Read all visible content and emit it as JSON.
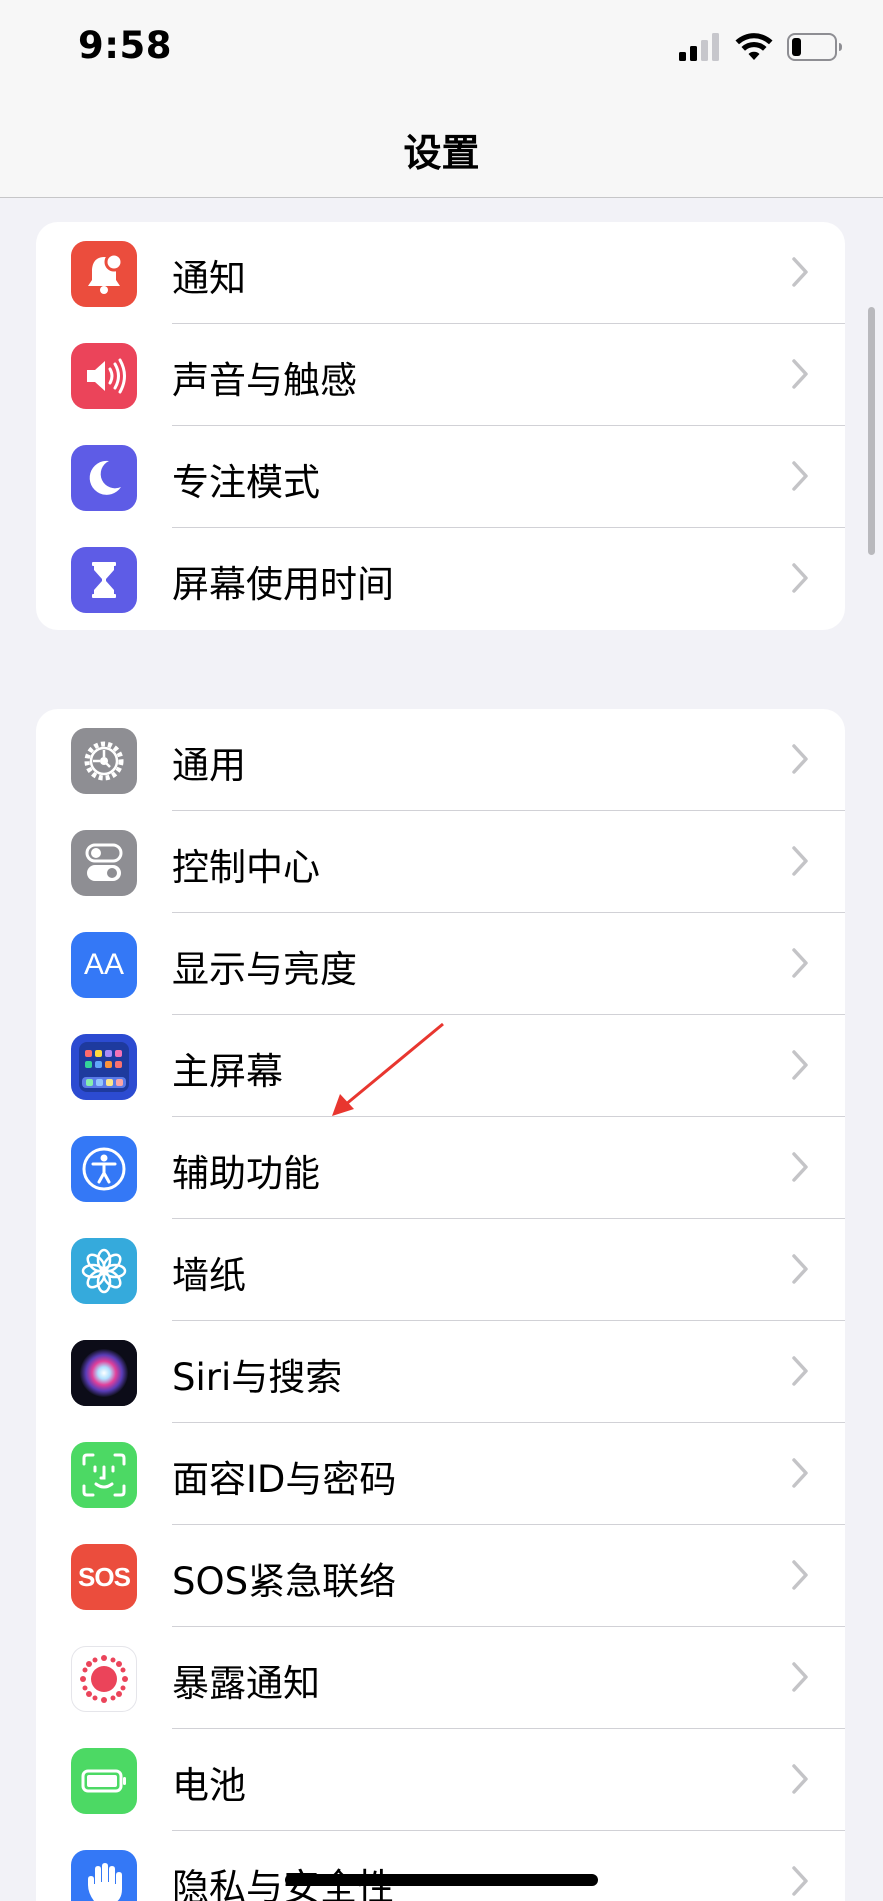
{
  "status_bar": {
    "time": "9:58",
    "icons": [
      "cellular-signal-icon",
      "wifi-icon",
      "battery-icon"
    ]
  },
  "nav": {
    "title": "设置"
  },
  "groups": [
    {
      "items": [
        {
          "label": "通知",
          "icon": "notification-bell-icon",
          "color": "#eb4d3d"
        },
        {
          "label": "声音与触感",
          "icon": "speaker-icon",
          "color": "#eb445a"
        },
        {
          "label": "专注模式",
          "icon": "moon-icon",
          "color": "#5e5ce6"
        },
        {
          "label": "屏幕使用时间",
          "icon": "hourglass-icon",
          "color": "#5e5ce6"
        }
      ]
    },
    {
      "items": [
        {
          "label": "通用",
          "icon": "gear-icon",
          "color": "#8e8e93"
        },
        {
          "label": "控制中心",
          "icon": "toggle-switches-icon",
          "color": "#8e8e93"
        },
        {
          "label": "显示与亮度",
          "icon": "text-size-icon",
          "icon_text": "AA",
          "color": "#3478f6"
        },
        {
          "label": "主屏幕",
          "icon": "home-grid-icon",
          "color": "#2c4bd1"
        },
        {
          "label": "辅助功能",
          "icon": "accessibility-icon",
          "color": "#3478f6"
        },
        {
          "label": "墙纸",
          "icon": "flower-icon",
          "color": "#35aadc"
        },
        {
          "label": "Siri与搜索",
          "icon": "siri-icon",
          "color": "#1c1c2e"
        },
        {
          "label": "面容ID与密码",
          "icon": "face-id-icon",
          "color": "#4cd964"
        },
        {
          "label": "SOS紧急联络",
          "icon": "sos-icon",
          "icon_text": "SOS",
          "color": "#eb4d3d"
        },
        {
          "label": "暴露通知",
          "icon": "exposure-icon",
          "color": "#eb445a"
        },
        {
          "label": "电池",
          "icon": "battery-icon",
          "color": "#4cd964"
        },
        {
          "label": "隐私与安全性",
          "icon": "hand-icon",
          "color": "#3478f6"
        }
      ]
    }
  ],
  "colors": {
    "background": "#f2f2f7",
    "annotation_arrow": "#e8362f"
  }
}
